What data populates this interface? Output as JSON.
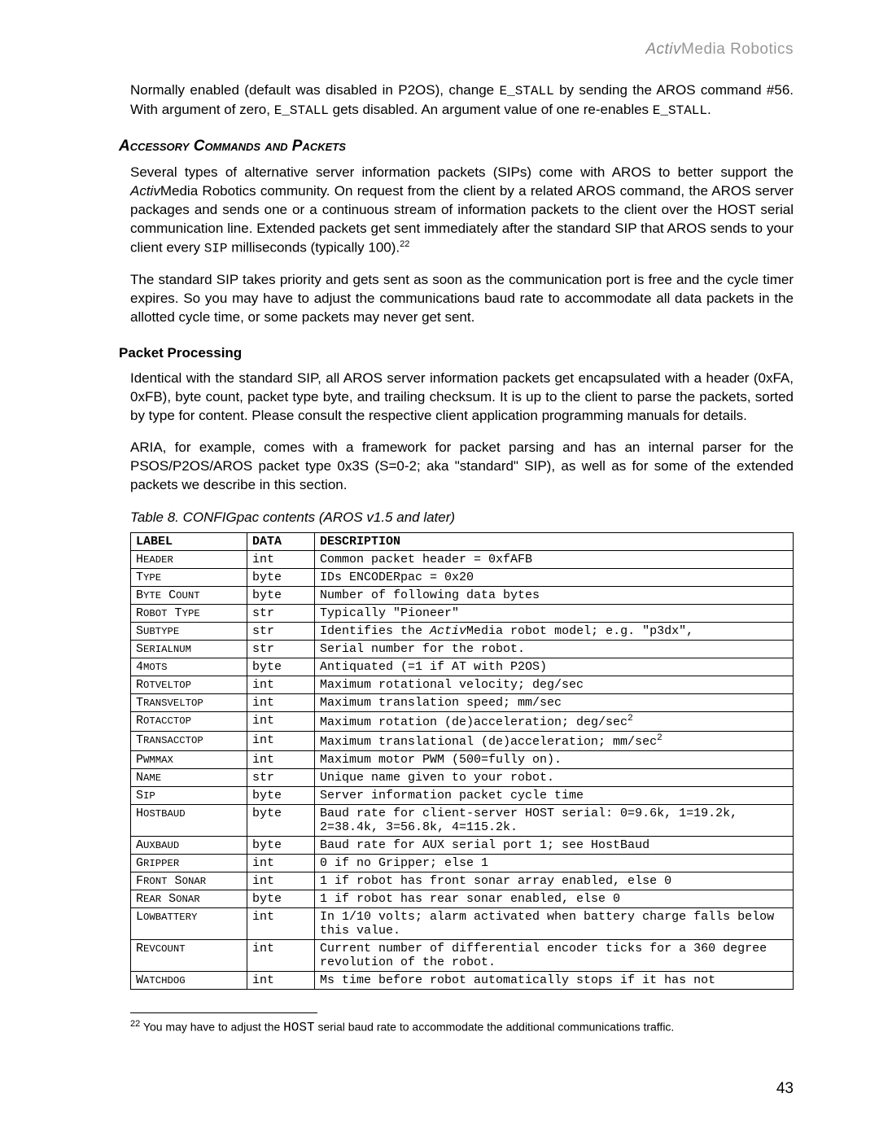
{
  "brand": {
    "strong": "Activ",
    "rest": "Media Robotics"
  },
  "paragraphs": {
    "p1a": "Normally enabled (default was disabled in P2OS), change ",
    "p1m1": "E_STALL",
    "p1b": " by sending the AROS command #56.  With argument of zero, ",
    "p1m2": "E_STALL",
    "p1c": " gets disabled.  An argument value of one re-enables ",
    "p1m3": "E_STALL",
    "p1d": ".",
    "p2a": "Several types of alternative server information packets (SIPs) come with AROS to better support the ",
    "p2i": "Activ",
    "p2b": "Media Robotics community.  On request from the client by a related AROS command, the AROS server packages and sends one or a continuous stream of information packets to the client over the HOST serial communication line.   Extended packets get sent immediately after the standard SIP that AROS sends to your client every ",
    "p2m": "SIP",
    "p2c": " milliseconds (typically 100).",
    "p2fn": "22",
    "p3": " The standard SIP takes priority and gets sent as soon as the communication port is free and the cycle timer expires.  So you may have to adjust the communications baud rate to accommodate all data packets in the allotted cycle time, or some packets may never get sent.",
    "p4": "Identical with the standard SIP, all AROS server information packets get encapsulated with a header (0xFA, 0xFB), byte count, packet type byte, and trailing checksum.   It is up to the client to parse the packets, sorted by type for content.  Please consult the respective client application programming manuals for details.",
    "p5": "ARIA, for example, comes with a framework for packet parsing and has an internal parser for the PSOS/P2OS/AROS packet type 0x3S (S=0-2; aka \"standard\" SIP), as well as for some of the extended packets we describe in this section."
  },
  "headings": {
    "accessory": "Accessory Commands and Packets",
    "packetproc": "Packet Processing"
  },
  "table_caption": "Table 8.  CONFIGpac contents (AROS v1.5 and later)",
  "table": {
    "head": {
      "label": "LABEL",
      "data": "DATA",
      "desc": "DESCRIPTION"
    },
    "rows": [
      {
        "label": "HEADER",
        "data": "int",
        "desc": "Common packet header = 0xfAFB"
      },
      {
        "label": "TYPE",
        "data": "byte",
        "desc": "IDs ENCODERpac = 0x20"
      },
      {
        "label": "BYTE COUNT",
        "data": "byte",
        "desc": "Number of following data bytes"
      },
      {
        "label": "ROBOT TYPE",
        "data": "str",
        "desc": "Typically \"Pioneer\""
      },
      {
        "label": "SUBTYPE",
        "data": " str",
        "desc": "Identifies the ActivMedia robot model; e.g. \"p3dx\","
      },
      {
        "label": "SERIALNUM",
        "data": " str",
        "desc": "Serial number for the robot."
      },
      {
        "label": "4MOTS",
        "data": "byte",
        "desc": "Antiquated (=1 if AT with P2OS)"
      },
      {
        "label": "ROTVELTOP",
        "data": " int",
        "desc": "Maximum rotational velocity; deg/sec"
      },
      {
        "label": "TRANSVELTOP",
        "data": " int",
        "desc": "Maximum translation speed; mm/sec"
      },
      {
        "label": "ROTACCTOP",
        "data": " int",
        "desc": "Maximum rotation (de)acceleration; deg/sec",
        "sup": "2"
      },
      {
        "label": "TRANSACCTOP",
        "data": " int",
        "desc": "Maximum translational (de)acceleration; mm/sec",
        "sup": "2"
      },
      {
        "label": "PWMMAX",
        "data": " int",
        "desc": "Maximum motor PWM (500=fully on)."
      },
      {
        "label": "NAME",
        "data": " str",
        "desc": "Unique name given to your robot."
      },
      {
        "label": "SIP",
        "data": "byte",
        "desc": "Server information packet cycle time"
      },
      {
        "label": "HOSTBAUD",
        "data": "byte",
        "desc": "Baud rate for client-server HOST serial: 0=9.6k, 1=19.2k, 2=38.4k, 3=56.8k, 4=115.2k."
      },
      {
        "label": "AUXBAUD",
        "data": "byte",
        "desc": "Baud rate for AUX serial port 1; see HostBaud"
      },
      {
        "label": "GRIPPER",
        "data": " int",
        "desc": "0 if no Gripper; else 1"
      },
      {
        "label": "FRONT SONAR",
        "data": " int",
        "desc": "1 if robot has front sonar array enabled, else 0"
      },
      {
        "label": "REAR SONAR",
        "data": "byte",
        "desc": "1 if robot has rear sonar enabled, else 0"
      },
      {
        "label": "LOWBATTERY",
        "data": " int",
        "desc": "In 1/10 volts; alarm activated when battery charge falls below this value."
      },
      {
        "label": "REVCOUNT",
        "data": " int",
        "desc": "Current number of differential encoder ticks for a 360 degree revolution of the robot."
      },
      {
        "label": "WATCHDOG",
        "data": " int",
        "desc": "Ms time before robot automatically stops if it has not"
      }
    ]
  },
  "footnote": {
    "num": "22",
    "texta": " You may have to adjust the ",
    "mono": "HOST",
    "textb": " serial baud rate to accommodate the additional communications traffic."
  },
  "page_number": "43"
}
